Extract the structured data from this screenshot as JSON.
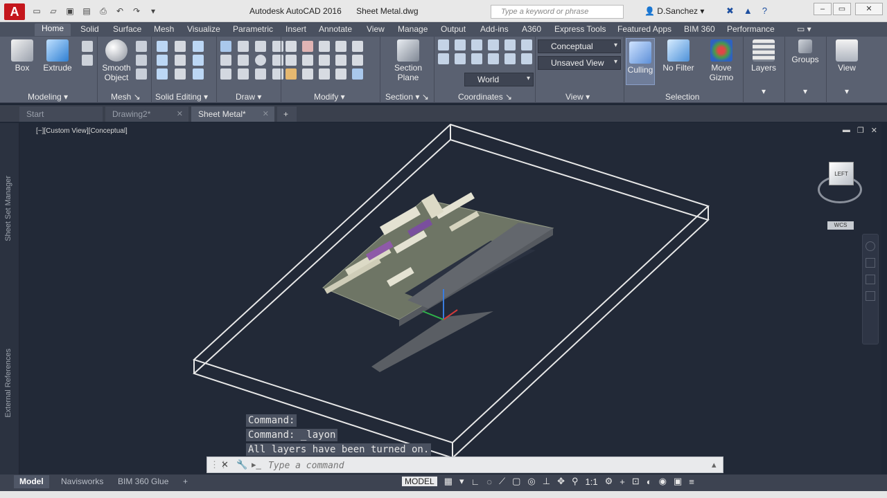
{
  "app": {
    "title": "Autodesk AutoCAD 2016",
    "document": "Sheet Metal.dwg",
    "logo": "A",
    "search_placeholder": "Type a keyword or phrase",
    "user": "D.Sanchez",
    "accent": "#c4161c"
  },
  "ribbon_tabs": [
    "Home",
    "Solid",
    "Surface",
    "Mesh",
    "Visualize",
    "Parametric",
    "Insert",
    "Annotate",
    "View",
    "Manage",
    "Output",
    "Add-ins",
    "A360",
    "Express Tools",
    "Featured Apps",
    "BIM 360",
    "Performance"
  ],
  "ribbon": {
    "box": "Box",
    "extrude": "Extrude",
    "smooth_object_1": "Smooth",
    "smooth_object_2": "Object",
    "section_plane_1": "Section",
    "section_plane_2": "Plane",
    "visual_style": "Conceptual",
    "view_name": "Unsaved View",
    "ucs": "World",
    "culling": "Culling",
    "no_filter": "No Filter",
    "move_gizmo_1": "Move",
    "move_gizmo_2": "Gizmo",
    "layers": "Layers",
    "groups": "Groups",
    "view": "View",
    "panels": {
      "modeling": "Modeling",
      "mesh": "Mesh",
      "solid_editing": "Solid Editing",
      "draw": "Draw",
      "modify": "Modify",
      "section": "Section",
      "coordinates": "Coordinates",
      "view": "View",
      "selection": "Selection"
    }
  },
  "doc_tabs": [
    {
      "label": "Start"
    },
    {
      "label": "Drawing2*"
    },
    {
      "label": "Sheet Metal*"
    }
  ],
  "viewport": {
    "label": "[−][Custom View][Conceptual]",
    "left_palettes": [
      "Sheet Set Manager",
      "External References"
    ],
    "viewcube_label": "LEFT",
    "wcs_label": "WCS"
  },
  "command": {
    "history": [
      "Command:",
      "Command: _layon",
      "All layers have been turned on."
    ],
    "placeholder": "Type a command"
  },
  "layout_tabs": [
    "Model",
    "Navisworks",
    "BIM 360 Glue"
  ],
  "status": {
    "model": "MODEL",
    "scale": "1:1"
  }
}
